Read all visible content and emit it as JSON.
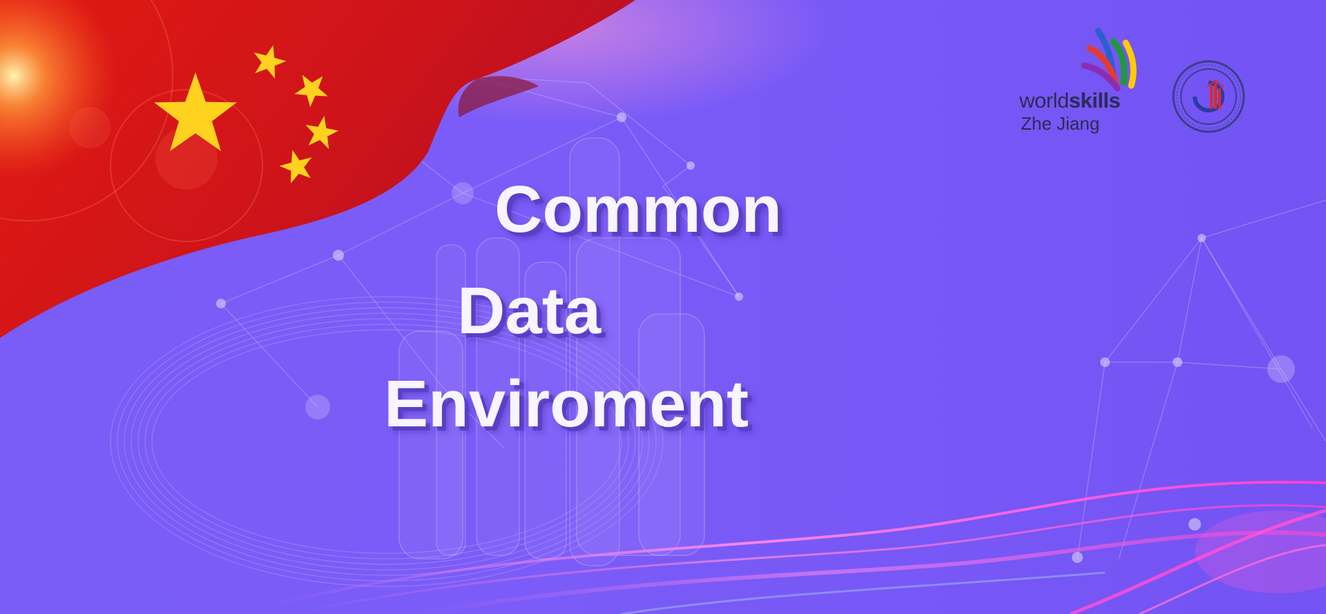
{
  "banner": {
    "title_lines": [
      "Common",
      "Data",
      "Enviroment"
    ]
  },
  "logos": {
    "worldskills": {
      "word_light": "world",
      "word_bold": "skills",
      "region": "Zhe Jiang"
    },
    "college_seal": {
      "icon": "college-seal-icon"
    }
  },
  "colors": {
    "background": "#7a5cf6",
    "flag_red": "#d9161b",
    "star_yellow": "#ffd21f",
    "title_text": "#f7f5ff",
    "title_shadow": "#5a3fc8"
  }
}
